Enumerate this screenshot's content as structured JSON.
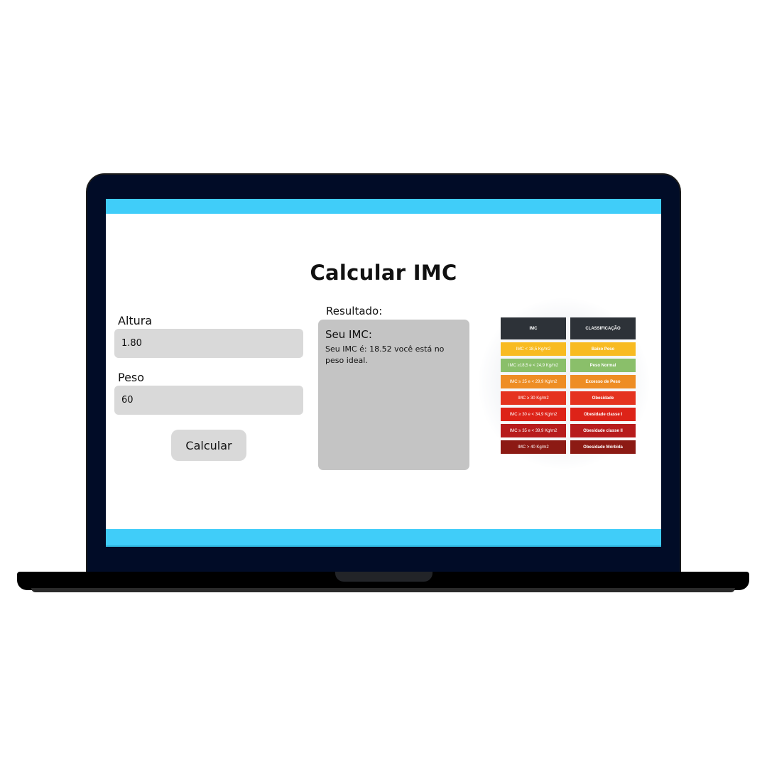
{
  "app": {
    "title": "Calcular IMC"
  },
  "form": {
    "altura_label": "Altura",
    "altura_value": "1.80",
    "peso_label": "Peso",
    "peso_value": "60",
    "button_label": "Calcular"
  },
  "result": {
    "label": "Resultado:",
    "heading": "Seu IMC:",
    "text": "Seu IMC é: 18.52 você está no peso ideal."
  },
  "imc_table": {
    "headers": [
      "IMC",
      "CLASSIFICAÇÃO"
    ],
    "header_color": "#2d3238",
    "rows": [
      {
        "range": "IMC < 18,5 Kg/m2",
        "class": "Baixo Peso",
        "color": "#f8bb21"
      },
      {
        "range": "IMC ≥18,5 e < 24,9 Kg/m2",
        "class": "Peso Normal",
        "color": "#8abf6a"
      },
      {
        "range": "IMC ≥ 25 e < 29,9 Kg/m2",
        "class": "Excesso de Peso",
        "color": "#ee8d24"
      },
      {
        "range": "IMC ≥ 30 Kg/m2",
        "class": "Obesidade",
        "color": "#e5331f"
      },
      {
        "range": "IMC ≥ 30 e < 34,9 Kg/m2",
        "class": "Obesidade classe I",
        "color": "#dd2318"
      },
      {
        "range": "IMC ≥ 35 e < 39,9 Kg/m2",
        "class": "Obesidade classe II",
        "color": "#b71c1c"
      },
      {
        "range": "IMC > 40 Kg/m2",
        "class": "Obesidade Mórbida",
        "color": "#8c1a14"
      }
    ]
  },
  "colors": {
    "accent_bar": "#40cdf9",
    "laptop_frame": "#010c27",
    "input_bg": "#d9d9d9",
    "result_bg": "#c4c4c4"
  }
}
